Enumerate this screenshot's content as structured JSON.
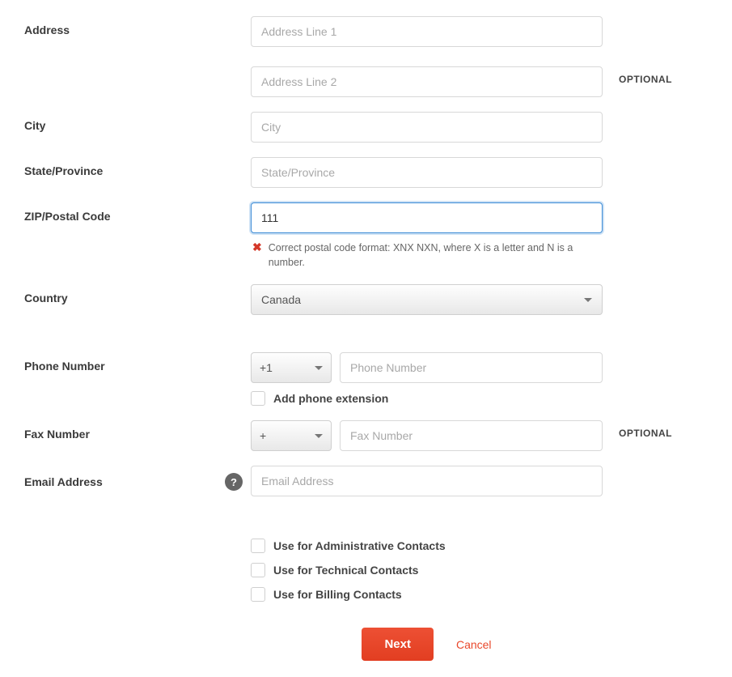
{
  "labels": {
    "address": "Address",
    "city": "City",
    "state": "State/Province",
    "zip": "ZIP/Postal Code",
    "country": "Country",
    "phone": "Phone Number",
    "fax": "Fax Number",
    "email": "Email Address"
  },
  "placeholders": {
    "addr1": "Address Line 1",
    "addr2": "Address Line 2",
    "city": "City",
    "state": "State/Province",
    "phone": "Phone Number",
    "fax": "Fax Number",
    "email": "Email Address"
  },
  "values": {
    "zip": "111",
    "country": "Canada",
    "phone_code": "+1",
    "fax_code": "+"
  },
  "tags": {
    "optional": "OPTIONAL"
  },
  "error": {
    "zip": "Correct postal code format: XNX NXN, where X is a letter and N is a number."
  },
  "checkboxes": {
    "phone_ext": "Add phone extension",
    "admin": "Use for Administrative Contacts",
    "tech": "Use for Technical Contacts",
    "billing": "Use for Billing Contacts"
  },
  "buttons": {
    "next": "Next",
    "cancel": "Cancel"
  },
  "help_icon": "?"
}
